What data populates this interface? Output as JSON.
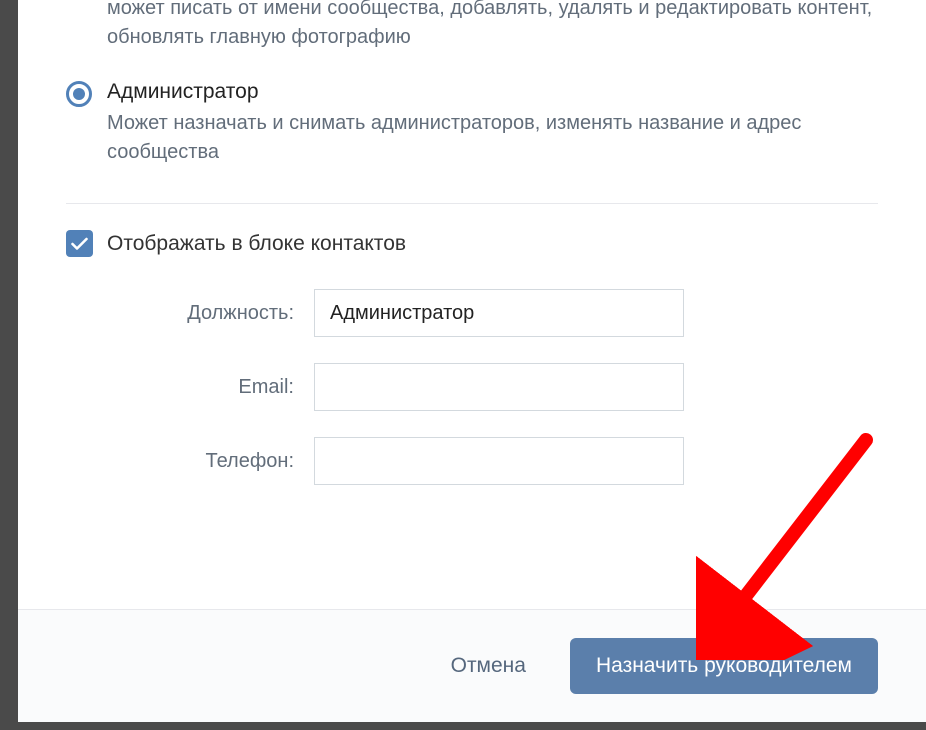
{
  "prior_role": {
    "description": "может писать от имени сообщества, добавлять, удалять и редактировать контент, обновлять главную фотографию"
  },
  "roles": {
    "admin": {
      "title": "Администратор",
      "description": "Может назначать и снимать администраторов, изменять название и адрес сообщества"
    }
  },
  "contacts": {
    "checkbox_label": "Отображать в блоке контактов",
    "checked": true
  },
  "form": {
    "position": {
      "label": "Должность:",
      "value": "Администратор"
    },
    "email": {
      "label": "Email:",
      "value": ""
    },
    "phone": {
      "label": "Телефон:",
      "value": ""
    }
  },
  "actions": {
    "cancel": "Отмена",
    "submit": "Назначить руководителем"
  }
}
